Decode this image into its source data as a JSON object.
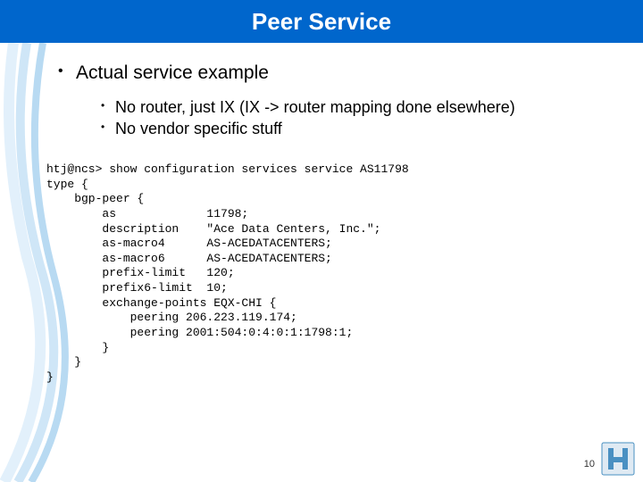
{
  "title": "Peer Service",
  "bullets": {
    "main": "Actual service example",
    "sub1": "No router, just IX (IX -> router mapping done elsewhere)",
    "sub2": "No vendor specific stuff"
  },
  "code": "htj@ncs> show configuration services service AS11798\ntype {\n    bgp-peer {\n        as             11798;\n        description    \"Ace Data Centers, Inc.\";\n        as-macro4      AS-ACEDATACENTERS;\n        as-macro6      AS-ACEDATACENTERS;\n        prefix-limit   120;\n        prefix6-limit  10;\n        exchange-points EQX-CHI {\n            peering 206.223.119.174;\n            peering 2001:504:0:4:0:1:1798:1;\n        }\n    }\n}",
  "page_number": "10"
}
